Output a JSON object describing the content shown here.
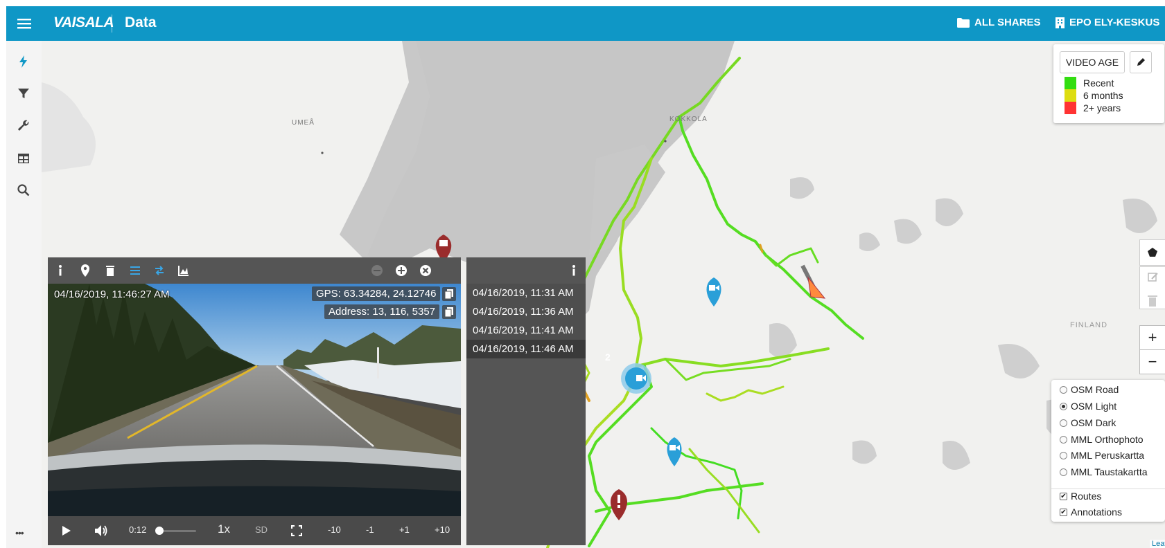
{
  "header": {
    "logo": "VAISALA",
    "title": "Data",
    "shares_label": "ALL SHARES",
    "org_label": "EPO ELY-KESKUS"
  },
  "sidebar": {
    "items": [
      "lightning-icon",
      "filter-icon",
      "wrench-icon",
      "table-icon",
      "search-icon"
    ],
    "more": "•••"
  },
  "map": {
    "labels": {
      "umea": "UMEÅ",
      "kokkola": "KOKKOLA",
      "finland": "FINLAND"
    },
    "cluster_count": "2",
    "attribution": "Leaflet"
  },
  "legend": {
    "title": "VIDEO AGE",
    "items": [
      {
        "label": "Recent",
        "color": "#33dd11"
      },
      {
        "label": "6 months",
        "color": "#dddd11"
      },
      {
        "label": "2+ years",
        "color": "#ff3333"
      }
    ]
  },
  "layers": {
    "base": [
      {
        "label": "OSM Road",
        "selected": false
      },
      {
        "label": "OSM Light",
        "selected": true
      },
      {
        "label": "OSM Dark",
        "selected": false
      },
      {
        "label": "MML Orthophoto",
        "selected": false
      },
      {
        "label": "MML Peruskartta",
        "selected": false
      },
      {
        "label": "MML Taustakartta",
        "selected": false
      }
    ],
    "overlays": [
      {
        "label": "Routes",
        "checked": true
      },
      {
        "label": "Annotations",
        "checked": true
      }
    ]
  },
  "video": {
    "timestamp": "04/16/2019, 11:46:27 AM",
    "gps": "GPS: 63.34284, 24.12746",
    "address": "Address: 13, 116, 5357",
    "current_time": "0:12",
    "speed": "1x",
    "quality": "SD",
    "progress": 0.06,
    "skip": [
      "-10",
      "-1",
      "+1",
      "+10"
    ]
  },
  "times": {
    "items": [
      "04/16/2019, 11:31 AM",
      "04/16/2019, 11:36 AM",
      "04/16/2019, 11:41 AM",
      "04/16/2019, 11:46 AM"
    ],
    "active": 3
  },
  "colors": {
    "header": "#0f97c6",
    "route_recent": "#55dd22",
    "route_mid": "#aadd22",
    "marker_blue": "#2a9fd8",
    "marker_red": "#9a2c2c"
  }
}
